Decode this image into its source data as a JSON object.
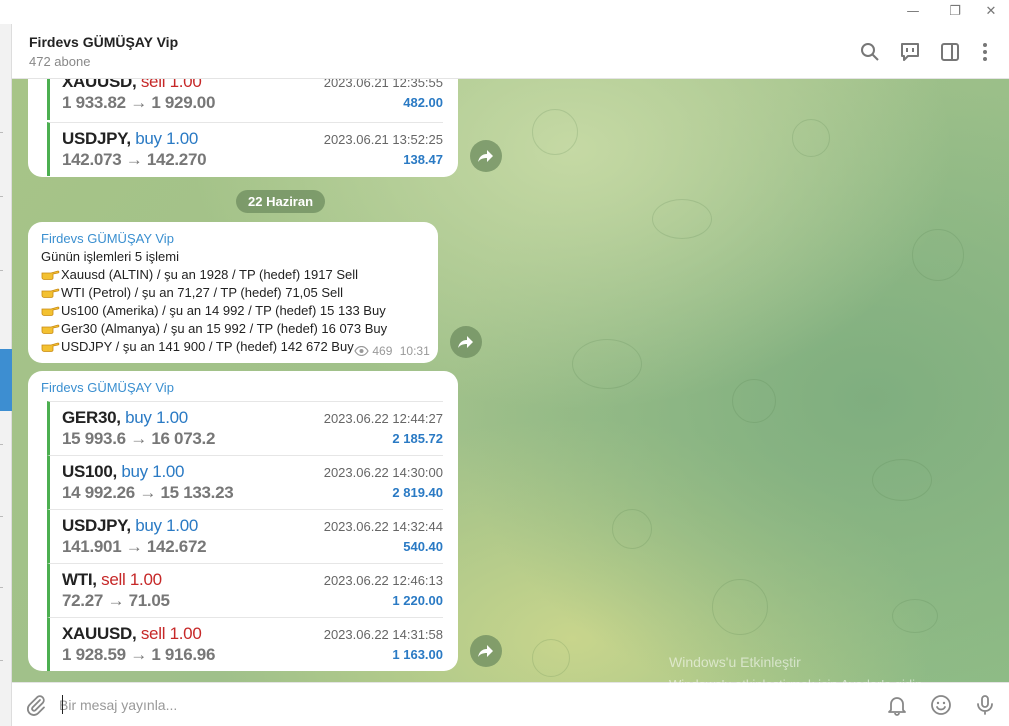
{
  "window": {
    "min": "—",
    "restore": "❐",
    "close": "✕"
  },
  "channel": {
    "title": "Firdevs GÜMÜŞAY Vip",
    "subtitle": "472 abone"
  },
  "icons": {
    "search": "search-icon",
    "discussion": "discussion-icon",
    "sidebar": "sidebar-toggle-icon",
    "more": "more-vertical-icon",
    "attach": "paperclip-icon",
    "bell": "bell-icon",
    "emoji": "emoji-icon",
    "mic": "microphone-icon",
    "forward": "forward-icon",
    "views": "eye-icon",
    "hand": "pointing-hand-emoji"
  },
  "colors": {
    "accent": "#3a8fd0",
    "sell": "#c62828",
    "buy": "#2a7ac4",
    "trade_bar": "#4caf50"
  },
  "top_bubble": {
    "trades": [
      {
        "symbol": "XAUUSD,",
        "side": "sell",
        "qty": "1.00",
        "prices": "1 933.82 → 1 929.00",
        "datetime": "2023.06.21 12:35:55",
        "profit": "482.00"
      },
      {
        "symbol": "USDJPY,",
        "side": "buy",
        "qty": "1.00",
        "prices": "142.073 → 142.270",
        "datetime": "2023.06.21 13:52:25",
        "profit": "138.47"
      }
    ]
  },
  "date_separator": "22 Haziran",
  "text_message": {
    "sender": "Firdevs GÜMÜŞAY Vip",
    "intro": "Günün işlemleri  5 işlemi",
    "lines": [
      "Xauusd (ALTIN)  / şu an 1928 / TP (hedef) 1917 Sell",
      "WTI (Petrol) / şu an 71,27 / TP (hedef) 71,05 Sell",
      "Us100 (Amerika) / şu an 14 992 / TP (hedef) 15 133  Buy",
      "Ger30 (Almanya) / şu an 15 992 / TP (hedef) 16 073 Buy",
      "USDJPY / şu an 141 900 /  TP (hedef) 142 672 Buy"
    ],
    "views": "469",
    "time": "10:31"
  },
  "trades_message": {
    "sender": "Firdevs GÜMÜŞAY Vip",
    "trades": [
      {
        "symbol": "GER30,",
        "side": "buy",
        "qty": "1.00",
        "prices": "15 993.6 → 16 073.2",
        "datetime": "2023.06.22 12:44:27",
        "profit": "2 185.72"
      },
      {
        "symbol": "US100,",
        "side": "buy",
        "qty": "1.00",
        "prices": "14 992.26 → 15 133.23",
        "datetime": "2023.06.22 14:30:00",
        "profit": "2 819.40"
      },
      {
        "symbol": "USDJPY,",
        "side": "buy",
        "qty": "1.00",
        "prices": "141.901 → 142.672",
        "datetime": "2023.06.22 14:32:44",
        "profit": "540.40"
      },
      {
        "symbol": "WTI,",
        "side": "sell",
        "qty": "1.00",
        "prices": "72.27 → 71.05",
        "datetime": "2023.06.22 12:46:13",
        "profit": "1 220.00"
      },
      {
        "symbol": "XAUUSD,",
        "side": "sell",
        "qty": "1.00",
        "prices": "1 928.59 → 1 916.96",
        "datetime": "2023.06.22 14:31:58",
        "profit": "1 163.00"
      }
    ]
  },
  "composer": {
    "placeholder": "Bir mesaj yayınla..."
  },
  "watermark": {
    "line1": "Windows'u Etkinleştir",
    "line2": "Windows'u etkinleştirmek için Ayarlar'a gidin."
  }
}
